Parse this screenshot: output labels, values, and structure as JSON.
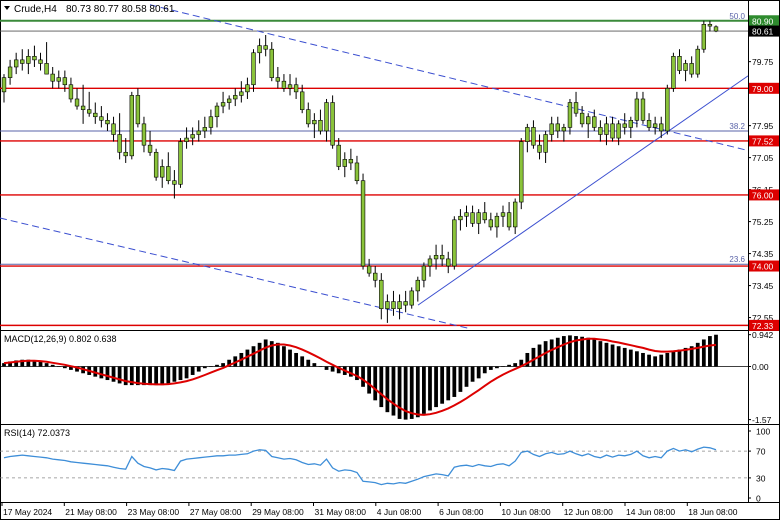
{
  "window": {
    "symbol_title": "Crude,H4",
    "ohlc_text": "80.73 80.77 80.58 80.61",
    "menu_icon": "dropdown-triangle-icon"
  },
  "colors": {
    "background": "#ffffff",
    "candle": "#8ac33a",
    "wick": "#000000",
    "support_line": "#dd0000",
    "price_label_bg": "#dd0000",
    "current_price_bg": "#000000",
    "fib_line": "#5a63a8",
    "fib_50_line": "#3a8a3a",
    "trend_line": "#3b4fd0",
    "macd_hist": "#000000",
    "macd_signal": "#dd0000",
    "rsi_line": "#3e8ed8"
  },
  "price_axis": {
    "ylim": [
      72.2,
      81.4
    ],
    "ticks": [
      {
        "label": "80.90",
        "value": 80.9,
        "style": "green"
      },
      {
        "label": "80.61",
        "value": 80.61,
        "style": "current"
      },
      {
        "label": "79.75",
        "value": 79.75,
        "style": "plain"
      },
      {
        "label": "79.00",
        "value": 79.0,
        "style": "red"
      },
      {
        "label": "77.95",
        "value": 77.95,
        "style": "plain"
      },
      {
        "label": "77.52",
        "value": 77.52,
        "style": "red"
      },
      {
        "label": "77.05",
        "value": 77.05,
        "style": "plain"
      },
      {
        "label": "76.15",
        "value": 76.15,
        "style": "plain"
      },
      {
        "label": "76.00",
        "value": 76.0,
        "style": "red"
      },
      {
        "label": "75.25",
        "value": 75.25,
        "style": "plain"
      },
      {
        "label": "74.35",
        "value": 74.35,
        "style": "plain"
      },
      {
        "label": "74.00",
        "value": 74.0,
        "style": "red"
      },
      {
        "label": "73.45",
        "value": 73.45,
        "style": "plain"
      },
      {
        "label": "72.55",
        "value": 72.55,
        "style": "plain"
      },
      {
        "label": "72.33",
        "value": 72.33,
        "style": "red"
      }
    ]
  },
  "levels": {
    "support_resistance": [
      79.0,
      77.52,
      76.0,
      74.0,
      72.33
    ],
    "current_price": 80.61
  },
  "fibonacci": [
    {
      "label": "50.0",
      "value": 80.9
    },
    {
      "label": "38.2",
      "value": 77.8
    },
    {
      "label": "23.6",
      "value": 74.05
    }
  ],
  "time_axis": {
    "labels": [
      "17 May 2024",
      "21 May 08:00",
      "23 May 08:00",
      "27 May 08:00",
      "29 May 08:00",
      "31 May 08:00",
      "4 Jun 08:00",
      "6 Jun 08:00",
      "10 Jun 08:00",
      "12 Jun 08:00",
      "14 Jun 08:00",
      "18 Jun 08:00"
    ]
  },
  "macd_panel": {
    "title": "MACD(12,26,9) 0.802 0.638",
    "ylim": [
      -1.7,
      1.05
    ],
    "ticks": [
      {
        "label": "0.942",
        "value": 0.942
      },
      {
        "label": "0.00",
        "value": 0.0
      },
      {
        "label": "-1.57",
        "value": -1.57
      }
    ]
  },
  "rsi_panel": {
    "title": "RSI(14) 72.0373",
    "ylim": [
      0,
      100
    ],
    "ticks": [
      {
        "label": "100",
        "value": 100
      },
      {
        "label": "70",
        "value": 70
      },
      {
        "label": "30",
        "value": 30
      },
      {
        "label": "0",
        "value": 0
      }
    ],
    "levels": [
      70,
      30
    ]
  },
  "chart_data": {
    "type": "candlestick",
    "symbol": "Crude",
    "timeframe": "H4",
    "ohlc": [
      [
        78.9,
        79.4,
        78.6,
        79.3
      ],
      [
        79.3,
        79.8,
        79.1,
        79.6
      ],
      [
        79.6,
        80.0,
        79.4,
        79.8
      ],
      [
        79.8,
        80.1,
        79.5,
        79.7
      ],
      [
        79.7,
        80.1,
        79.4,
        79.9
      ],
      [
        79.9,
        80.2,
        79.6,
        79.8
      ],
      [
        79.8,
        80.0,
        79.5,
        79.7
      ],
      [
        79.7,
        80.3,
        79.4,
        79.4
      ],
      [
        79.4,
        79.6,
        79.0,
        79.2
      ],
      [
        79.2,
        79.5,
        79.0,
        79.3
      ],
      [
        79.3,
        79.5,
        78.9,
        79.1
      ],
      [
        79.1,
        79.3,
        78.6,
        78.7
      ],
      [
        78.7,
        79.0,
        78.4,
        78.5
      ],
      [
        78.5,
        79.1,
        78.0,
        78.4
      ],
      [
        78.4,
        78.9,
        78.2,
        78.3
      ],
      [
        78.3,
        78.6,
        78.0,
        78.2
      ],
      [
        78.2,
        78.5,
        77.9,
        78.1
      ],
      [
        78.1,
        78.3,
        77.8,
        78.0
      ],
      [
        78.0,
        78.2,
        77.5,
        77.7
      ],
      [
        77.7,
        78.3,
        77.0,
        77.2
      ],
      [
        77.2,
        77.6,
        76.9,
        77.1
      ],
      [
        77.1,
        78.9,
        77.0,
        78.8
      ],
      [
        78.8,
        79.0,
        77.9,
        78.0
      ],
      [
        78.0,
        78.2,
        77.2,
        77.4
      ],
      [
        77.4,
        77.8,
        77.1,
        77.2
      ],
      [
        77.2,
        77.3,
        76.4,
        76.5
      ],
      [
        76.5,
        77.0,
        76.2,
        76.8
      ],
      [
        76.8,
        77.2,
        76.3,
        76.4
      ],
      [
        76.4,
        76.7,
        75.9,
        76.3
      ],
      [
        76.3,
        77.6,
        76.2,
        77.5
      ],
      [
        77.5,
        77.9,
        77.3,
        77.6
      ],
      [
        77.6,
        77.9,
        77.4,
        77.7
      ],
      [
        77.7,
        78.1,
        77.5,
        77.8
      ],
      [
        77.8,
        78.2,
        77.6,
        77.9
      ],
      [
        77.9,
        78.4,
        77.7,
        78.2
      ],
      [
        78.2,
        78.6,
        77.9,
        78.5
      ],
      [
        78.5,
        78.9,
        78.3,
        78.6
      ],
      [
        78.6,
        78.8,
        78.4,
        78.7
      ],
      [
        78.7,
        79.0,
        78.5,
        78.8
      ],
      [
        78.8,
        79.2,
        78.6,
        78.9
      ],
      [
        78.9,
        79.3,
        78.7,
        79.1
      ],
      [
        79.1,
        80.1,
        78.9,
        80.0
      ],
      [
        80.0,
        80.4,
        79.7,
        80.2
      ],
      [
        80.2,
        80.5,
        79.9,
        80.1
      ],
      [
        80.1,
        80.3,
        79.2,
        79.3
      ],
      [
        79.3,
        79.6,
        79.0,
        79.2
      ],
      [
        79.2,
        79.4,
        78.9,
        79.0
      ],
      [
        79.0,
        79.4,
        78.8,
        79.1
      ],
      [
        79.1,
        79.3,
        78.7,
        78.9
      ],
      [
        78.9,
        79.1,
        78.3,
        78.4
      ],
      [
        78.4,
        78.6,
        77.9,
        78.0
      ],
      [
        78.0,
        78.3,
        77.6,
        78.1
      ],
      [
        78.1,
        78.4,
        77.7,
        77.8
      ],
      [
        77.8,
        78.7,
        77.5,
        78.6
      ],
      [
        78.6,
        78.8,
        77.3,
        77.4
      ],
      [
        77.4,
        77.6,
        76.7,
        76.8
      ],
      [
        76.8,
        77.2,
        76.5,
        77.0
      ],
      [
        77.0,
        77.3,
        76.7,
        76.9
      ],
      [
        76.9,
        77.1,
        76.3,
        76.4
      ],
      [
        76.4,
        76.6,
        73.9,
        74.0
      ],
      [
        74.0,
        74.2,
        73.7,
        73.8
      ],
      [
        73.8,
        74.0,
        73.4,
        73.6
      ],
      [
        73.6,
        73.8,
        72.5,
        72.8
      ],
      [
        72.8,
        73.2,
        72.4,
        73.0
      ],
      [
        73.0,
        73.3,
        72.6,
        72.8
      ],
      [
        72.8,
        73.2,
        72.5,
        73.0
      ],
      [
        73.0,
        73.3,
        72.7,
        72.9
      ],
      [
        72.9,
        73.4,
        72.8,
        73.3
      ],
      [
        73.3,
        73.7,
        73.0,
        73.6
      ],
      [
        73.6,
        74.1,
        73.4,
        74.0
      ],
      [
        74.0,
        74.3,
        73.7,
        74.2
      ],
      [
        74.2,
        74.6,
        73.9,
        74.3
      ],
      [
        74.3,
        74.6,
        74.0,
        74.2
      ],
      [
        74.2,
        74.4,
        73.8,
        74.0
      ],
      [
        74.0,
        75.4,
        73.9,
        75.3
      ],
      [
        75.3,
        75.6,
        75.0,
        75.4
      ],
      [
        75.4,
        75.7,
        75.1,
        75.5
      ],
      [
        75.5,
        75.7,
        75.1,
        75.2
      ],
      [
        75.2,
        75.6,
        74.9,
        75.5
      ],
      [
        75.5,
        75.8,
        75.2,
        75.3
      ],
      [
        75.3,
        75.5,
        75.0,
        75.1
      ],
      [
        75.1,
        75.5,
        74.8,
        75.4
      ],
      [
        75.4,
        75.7,
        75.1,
        75.5
      ],
      [
        75.5,
        75.8,
        75.0,
        75.1
      ],
      [
        75.1,
        75.9,
        74.9,
        75.8
      ],
      [
        75.8,
        77.6,
        75.6,
        77.5
      ],
      [
        77.5,
        78.0,
        77.2,
        77.9
      ],
      [
        77.9,
        78.1,
        77.3,
        77.4
      ],
      [
        77.4,
        77.7,
        77.0,
        77.2
      ],
      [
        77.2,
        77.8,
        76.9,
        77.7
      ],
      [
        77.7,
        78.2,
        77.5,
        78.0
      ],
      [
        78.0,
        78.2,
        77.6,
        77.8
      ],
      [
        77.8,
        78.0,
        77.5,
        77.9
      ],
      [
        77.9,
        78.7,
        77.7,
        78.6
      ],
      [
        78.6,
        78.9,
        78.2,
        78.3
      ],
      [
        78.3,
        78.5,
        77.9,
        78.0
      ],
      [
        78.0,
        78.3,
        77.6,
        78.2
      ],
      [
        78.2,
        78.4,
        77.8,
        77.9
      ],
      [
        77.9,
        78.1,
        77.5,
        77.7
      ],
      [
        77.7,
        78.2,
        77.4,
        78.0
      ],
      [
        78.0,
        78.2,
        77.5,
        77.6
      ],
      [
        77.6,
        78.1,
        77.4,
        78.0
      ],
      [
        78.0,
        78.3,
        77.7,
        77.9
      ],
      [
        77.9,
        78.2,
        77.6,
        78.1
      ],
      [
        78.1,
        78.9,
        77.9,
        78.7
      ],
      [
        78.7,
        78.9,
        78.0,
        78.1
      ],
      [
        78.1,
        78.3,
        77.8,
        77.9
      ],
      [
        77.9,
        78.2,
        77.7,
        78.0
      ],
      [
        78.0,
        78.2,
        77.6,
        77.8
      ],
      [
        77.8,
        79.1,
        77.7,
        79.0
      ],
      [
        79.0,
        80.0,
        78.9,
        79.9
      ],
      [
        79.9,
        80.1,
        79.4,
        79.5
      ],
      [
        79.5,
        79.8,
        79.2,
        79.7
      ],
      [
        79.7,
        79.9,
        79.3,
        79.4
      ],
      [
        79.4,
        80.2,
        79.3,
        80.1
      ],
      [
        80.1,
        80.9,
        80.0,
        80.8
      ],
      [
        80.8,
        80.9,
        80.6,
        80.75
      ],
      [
        80.73,
        80.77,
        80.58,
        80.61
      ]
    ],
    "macd_histogram": [
      0.1,
      0.15,
      0.18,
      0.2,
      0.2,
      0.18,
      0.15,
      0.1,
      0.05,
      0.0,
      -0.05,
      -0.1,
      -0.15,
      -0.2,
      -0.25,
      -0.3,
      -0.35,
      -0.4,
      -0.45,
      -0.5,
      -0.55,
      -0.55,
      -0.55,
      -0.55,
      -0.55,
      -0.55,
      -0.55,
      -0.5,
      -0.45,
      -0.4,
      -0.35,
      -0.25,
      -0.15,
      -0.05,
      0.0,
      0.05,
      0.1,
      0.2,
      0.3,
      0.4,
      0.5,
      0.6,
      0.7,
      0.8,
      0.75,
      0.7,
      0.6,
      0.5,
      0.4,
      0.3,
      0.2,
      0.1,
      0.0,
      -0.1,
      -0.15,
      -0.2,
      -0.25,
      -0.3,
      -0.4,
      -0.6,
      -0.8,
      -1.0,
      -1.2,
      -1.35,
      -1.45,
      -1.55,
      -1.57,
      -1.55,
      -1.5,
      -1.4,
      -1.3,
      -1.2,
      -1.1,
      -1.0,
      -0.9,
      -0.75,
      -0.6,
      -0.45,
      -0.35,
      -0.2,
      -0.1,
      -0.05,
      0.0,
      0.05,
      0.1,
      0.2,
      0.4,
      0.55,
      0.65,
      0.75,
      0.8,
      0.85,
      0.9,
      0.92,
      0.9,
      0.88,
      0.85,
      0.8,
      0.75,
      0.7,
      0.65,
      0.6,
      0.55,
      0.5,
      0.45,
      0.4,
      0.35,
      0.3,
      0.35,
      0.4,
      0.45,
      0.5,
      0.55,
      0.6,
      0.7,
      0.8,
      0.9,
      0.94
    ],
    "macd_signal": [
      0.1,
      0.12,
      0.14,
      0.16,
      0.17,
      0.17,
      0.16,
      0.14,
      0.11,
      0.08,
      0.05,
      0.01,
      -0.03,
      -0.08,
      -0.13,
      -0.18,
      -0.23,
      -0.28,
      -0.33,
      -0.38,
      -0.43,
      -0.46,
      -0.49,
      -0.51,
      -0.52,
      -0.53,
      -0.53,
      -0.52,
      -0.5,
      -0.47,
      -0.43,
      -0.38,
      -0.32,
      -0.25,
      -0.18,
      -0.11,
      -0.04,
      0.04,
      0.12,
      0.2,
      0.29,
      0.38,
      0.47,
      0.56,
      0.62,
      0.65,
      0.65,
      0.62,
      0.57,
      0.5,
      0.42,
      0.33,
      0.24,
      0.14,
      0.05,
      -0.04,
      -0.12,
      -0.2,
      -0.28,
      -0.39,
      -0.52,
      -0.67,
      -0.82,
      -0.97,
      -1.1,
      -1.22,
      -1.32,
      -1.38,
      -1.42,
      -1.43,
      -1.41,
      -1.37,
      -1.31,
      -1.24,
      -1.15,
      -1.05,
      -0.94,
      -0.82,
      -0.7,
      -0.57,
      -0.45,
      -0.34,
      -0.24,
      -0.15,
      -0.07,
      0.01,
      0.1,
      0.2,
      0.3,
      0.4,
      0.49,
      0.57,
      0.65,
      0.72,
      0.77,
      0.8,
      0.82,
      0.82,
      0.8,
      0.78,
      0.74,
      0.71,
      0.67,
      0.63,
      0.59,
      0.55,
      0.5,
      0.46,
      0.44,
      0.44,
      0.45,
      0.47,
      0.49,
      0.52,
      0.55,
      0.59,
      0.62,
      0.638
    ],
    "rsi": [
      60,
      62,
      63,
      64,
      63,
      62,
      61,
      60,
      58,
      57,
      56,
      54,
      53,
      52,
      51,
      50,
      49,
      48,
      46,
      44,
      43,
      62,
      52,
      47,
      45,
      42,
      44,
      43,
      41,
      55,
      58,
      59,
      60,
      61,
      62,
      63,
      63,
      64,
      64,
      65,
      66,
      70,
      72,
      71,
      62,
      60,
      58,
      59,
      57,
      53,
      50,
      51,
      49,
      58,
      45,
      40,
      42,
      41,
      38,
      25,
      24,
      23,
      20,
      22,
      21,
      23,
      22,
      25,
      28,
      32,
      34,
      36,
      35,
      33,
      46,
      48,
      49,
      47,
      50,
      48,
      47,
      50,
      51,
      48,
      55,
      68,
      70,
      65,
      62,
      66,
      68,
      65,
      66,
      70,
      66,
      63,
      66,
      62,
      60,
      64,
      61,
      64,
      63,
      65,
      70,
      63,
      60,
      62,
      60,
      70,
      74,
      70,
      72,
      69,
      73,
      76,
      75,
      72
    ]
  }
}
